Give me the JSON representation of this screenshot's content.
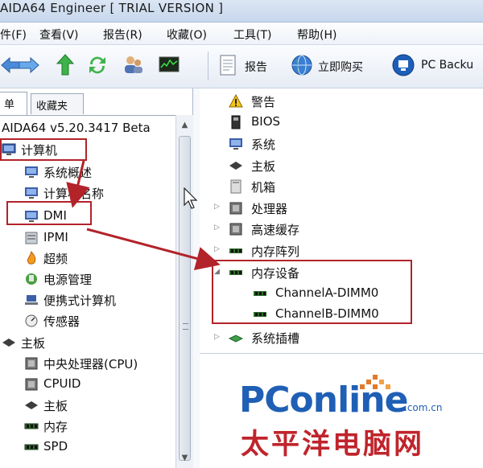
{
  "window": {
    "title": "AIDA64 Engineer  [ TRIAL VERSION ]"
  },
  "menu": {
    "items": [
      "件(F)",
      "查看(V)",
      "报告(R)",
      "收藏(O)",
      "工具(T)",
      "帮助(H)"
    ]
  },
  "toolbar": {
    "report_label": "报告",
    "buy_label": "立即购买",
    "backup_label": "PC Backu"
  },
  "left_panel": {
    "tabs": [
      "单",
      "收藏夹"
    ],
    "tree": {
      "root": "AIDA64 v5.20.3417 Beta",
      "computer": "计算机",
      "computer_children": [
        "系统概述",
        "计算机名称",
        "DMI",
        "IPMI",
        "超频",
        "电源管理",
        "便携式计算机",
        "传感器"
      ],
      "motherboard": "主板",
      "motherboard_children": [
        "中央处理器(CPU)",
        "CPUID",
        "主板",
        "内存",
        "SPD"
      ]
    }
  },
  "right_panel": {
    "items": [
      "警告",
      "BIOS",
      "系统",
      "主板",
      "机箱",
      "处理器",
      "高速缓存",
      "内存阵列",
      "内存设备"
    ],
    "memory_devices": [
      "ChannelA-DIMM0",
      "ChannelB-DIMM0"
    ],
    "last_item": "系统插槽"
  },
  "watermark": {
    "brand": "PConline",
    "domain": ".com.cn",
    "cn": "太平洋电脑网"
  },
  "colors": {
    "highlight": "#b2232a",
    "brand_blue": "#1f5fb5",
    "brand_red": "#c0242c"
  }
}
